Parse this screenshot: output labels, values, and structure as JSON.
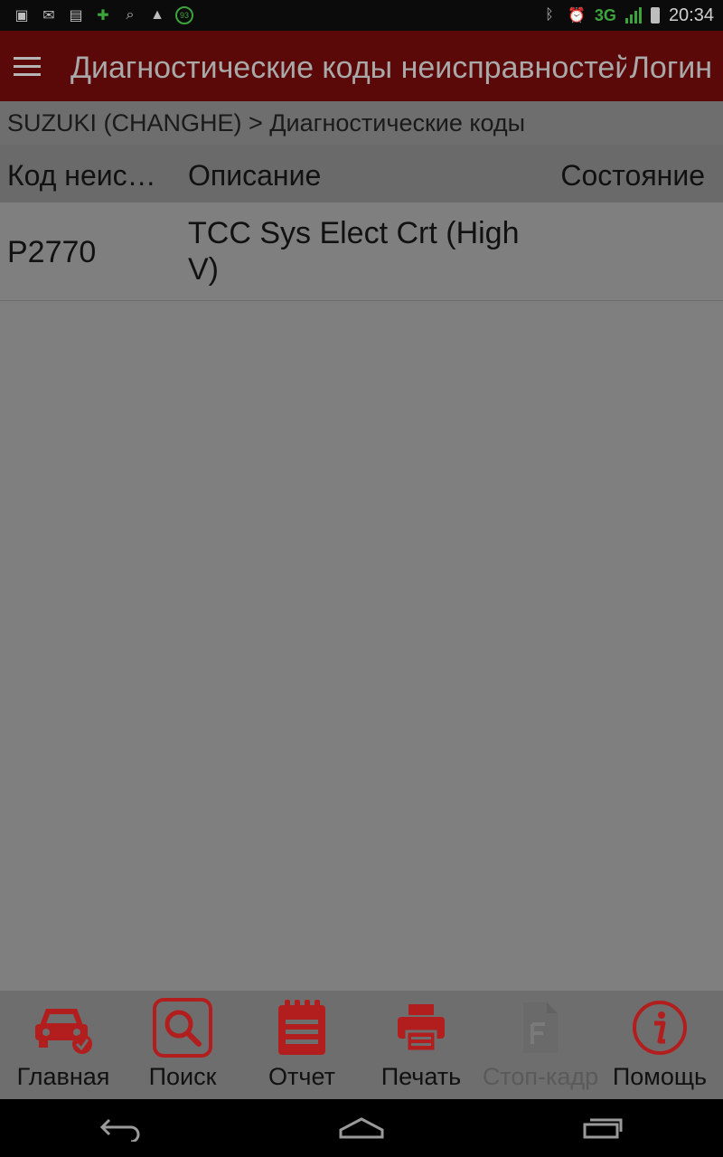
{
  "statusbar": {
    "icons": [
      "image-icon",
      "sms-icon",
      "chat-icon",
      "clover-icon",
      "search-icon",
      "warning-icon",
      "badge-93-icon"
    ],
    "badge": "93",
    "network": "3G",
    "time": "20:34"
  },
  "appbar": {
    "title": "Диагностические коды неисправностей",
    "login": "Логин"
  },
  "breadcrumb": "SUZUKI (CHANGHE) > Диагностические коды",
  "table": {
    "headers": [
      "Код неисправности",
      "Описание",
      "Состояние"
    ],
    "rows": [
      {
        "code": "P2770",
        "description": "TCC Sys Elect Crt (High V)",
        "state": ""
      }
    ]
  },
  "toolbar": {
    "items": [
      {
        "label": "Главная",
        "icon": "car-home-icon"
      },
      {
        "label": "Поиск",
        "icon": "search-icon"
      },
      {
        "label": "Отчет",
        "icon": "report-icon"
      },
      {
        "label": "Печать",
        "icon": "printer-icon"
      },
      {
        "label": "Стоп-кадр",
        "icon": "freeze-frame-icon"
      },
      {
        "label": "Помощь",
        "icon": "help-icon"
      }
    ]
  },
  "colors": {
    "accent": "#b21e1e",
    "header": "#5a0808",
    "overlay": "#7f7f7f"
  }
}
